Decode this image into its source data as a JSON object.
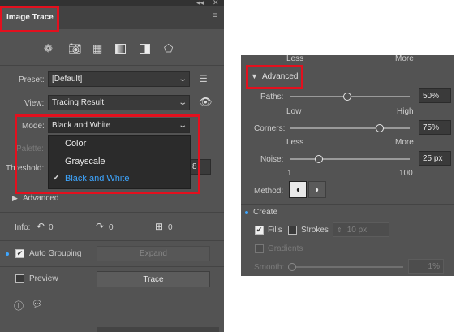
{
  "left": {
    "title": "Image Trace",
    "icons": [
      "auto-color-icon",
      "camera-icon",
      "grid-icon",
      "gradient-icon",
      "half-icon",
      "shape-icon"
    ],
    "preset_label": "Preset:",
    "preset_value": "[Default]",
    "view_label": "View:",
    "view_value": "Tracing Result",
    "mode_label": "Mode:",
    "mode_value": "Black and White",
    "palette_label": "Palette:",
    "threshold_label": "Threshold:",
    "threshold_partial": "8",
    "mode_options": [
      "Color",
      "Grayscale",
      "Black and White"
    ],
    "selected_option": "Black and White",
    "advanced_label": "Advanced",
    "info_label": "Info:",
    "info_paths": "0",
    "info_anchors": "0",
    "info_colors": "0",
    "auto_grouping_label": "Auto Grouping",
    "expand_label": "Expand",
    "preview_label": "Preview",
    "trace_label": "Trace"
  },
  "right": {
    "less_top": "Less",
    "more_top": "More",
    "advanced_label": "Advanced",
    "paths_label": "Paths:",
    "paths_value": "50%",
    "paths_fraction": 0.48,
    "low_label": "Low",
    "high_label": "High",
    "corners_label": "Corners:",
    "corners_value": "75%",
    "corners_fraction": 0.75,
    "less_label": "Less",
    "more_label": "More",
    "noise_label": "Noise:",
    "noise_value": "25 px",
    "noise_fraction": 0.24,
    "noise_min": "1",
    "noise_max": "100",
    "method_label": "Method:",
    "create_label": "Create",
    "fills_label": "Fills",
    "strokes_label": "Strokes",
    "stroke_value": "10 px",
    "gradients_label": "Gradients",
    "smooth_label": "Smooth:",
    "smooth_value": "1%"
  },
  "colors": {
    "panel": "#535353",
    "highlight_red": "#e3101e",
    "selected_blue": "#3ea6ff"
  }
}
